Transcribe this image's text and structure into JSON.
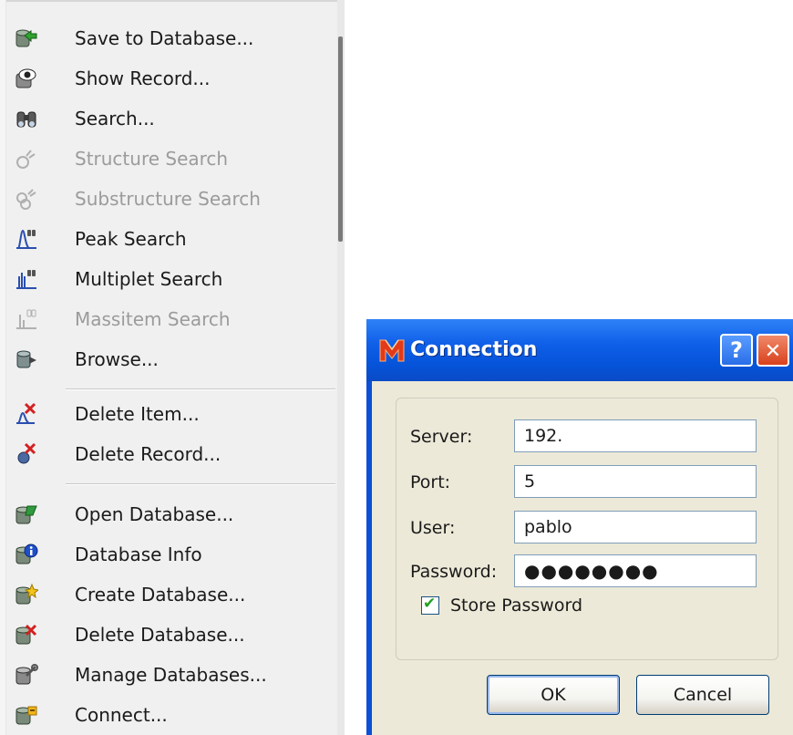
{
  "menu": {
    "items": [
      {
        "label": "Save to Database...",
        "icon": "save-database-icon",
        "enabled": true
      },
      {
        "label": "Show Record...",
        "icon": "eye-icon",
        "enabled": true
      },
      {
        "label": "Search...",
        "icon": "binoculars-icon",
        "enabled": true
      },
      {
        "label": "Structure Search",
        "icon": "structure-search-icon",
        "enabled": false
      },
      {
        "label": "Substructure Search",
        "icon": "substructure-search-icon",
        "enabled": false
      },
      {
        "label": "Peak Search",
        "icon": "peak-search-icon",
        "enabled": true
      },
      {
        "label": "Multiplet Search",
        "icon": "multiplet-search-icon",
        "enabled": true
      },
      {
        "label": "Massitem Search",
        "icon": "massitem-search-icon",
        "enabled": false
      },
      {
        "label": "Browse...",
        "icon": "browse-database-icon",
        "enabled": true
      },
      {
        "label": "Delete Item...",
        "icon": "delete-item-icon",
        "enabled": true
      },
      {
        "label": "Delete Record...",
        "icon": "delete-record-icon",
        "enabled": true
      },
      {
        "label": "Open Database...",
        "icon": "open-database-icon",
        "enabled": true
      },
      {
        "label": "Database Info",
        "icon": "database-info-icon",
        "enabled": true
      },
      {
        "label": "Create Database...",
        "icon": "create-database-icon",
        "enabled": true
      },
      {
        "label": "Delete Database...",
        "icon": "delete-database-icon",
        "enabled": true
      },
      {
        "label": "Manage Databases...",
        "icon": "manage-databases-icon",
        "enabled": true
      },
      {
        "label": "Connect...",
        "icon": "connect-database-icon",
        "enabled": true
      }
    ]
  },
  "dialog": {
    "title": "Connection",
    "help_glyph": "?",
    "close_glyph": "✕",
    "fields": {
      "server": {
        "label": "Server:",
        "value": "192."
      },
      "port": {
        "label": "Port:",
        "value": "5"
      },
      "user": {
        "label": "User:",
        "value": "pablo"
      },
      "password": {
        "label": "Password:",
        "value": "●●●●●●●●"
      }
    },
    "store_password": {
      "label": "Store Password",
      "checked": true,
      "mark": "✔"
    },
    "ok_label": "OK",
    "cancel_label": "Cancel"
  },
  "colors": {
    "titlebar": "#0553d8",
    "dialog_face": "#ece9d8",
    "close_button": "#d9401c",
    "menu_background": "#f0f0f0"
  }
}
